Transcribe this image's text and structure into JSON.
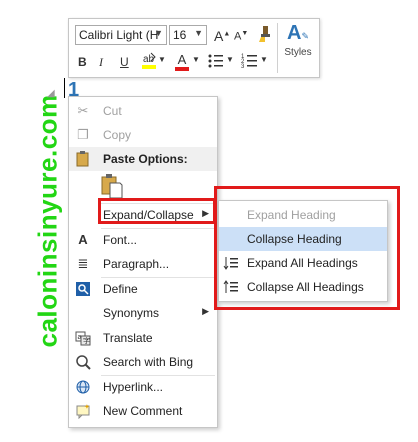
{
  "watermark": "caloninsinyure.com",
  "heading_number": "1",
  "mini_toolbar": {
    "font_name": "Calibri Light (H",
    "font_size": "16",
    "grow_font": "A",
    "shrink_font": "A",
    "bold": "B",
    "italic": "I",
    "underline": "U",
    "font_color": "A",
    "styles_label": "Styles"
  },
  "context_menu": {
    "items": [
      {
        "label": "Cut",
        "icon": "scissors-icon",
        "disabled": true
      },
      {
        "label": "Copy",
        "icon": "copy-icon",
        "disabled": true
      },
      {
        "label": "Paste Options:",
        "icon": "clipboard-icon"
      },
      {
        "label": "Expand/Collapse",
        "icon": "",
        "has_submenu": true
      },
      {
        "label": "Font...",
        "icon": "font-icon"
      },
      {
        "label": "Paragraph...",
        "icon": "paragraph-icon"
      },
      {
        "label": "Define",
        "icon": "define-icon"
      },
      {
        "label": "Synonyms",
        "icon": "",
        "has_submenu": true
      },
      {
        "label": "Translate",
        "icon": "translate-icon"
      },
      {
        "label": "Search with Bing",
        "icon": "search-icon"
      },
      {
        "label": "Hyperlink...",
        "icon": "link-icon"
      },
      {
        "label": "New Comment",
        "icon": "comment-icon"
      }
    ]
  },
  "submenu": {
    "items": [
      {
        "label": "Expand Heading",
        "disabled": true
      },
      {
        "label": "Collapse Heading",
        "highlighted": true
      },
      {
        "label": "Expand All Headings",
        "icon": "expand-all-icon"
      },
      {
        "label": "Collapse All Headings",
        "icon": "collapse-all-icon"
      }
    ]
  },
  "colors": {
    "highlight_accent": "#e11a1a",
    "menu_hover": "#cce0f7",
    "watermark": "#22d614",
    "heading_blue": "#2e74b5"
  }
}
